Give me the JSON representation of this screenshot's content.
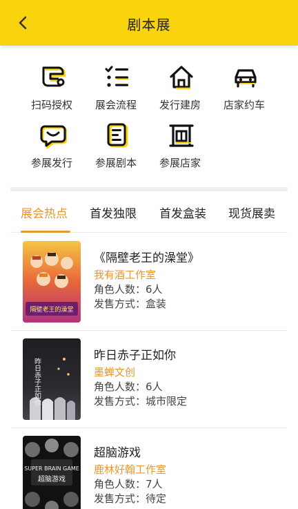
{
  "header": {
    "title": "剧本展",
    "back_icon": "chevron-left-icon",
    "color": "#f9d30d"
  },
  "menu": [
    {
      "label": "扫码授权",
      "icon": "scan-auth-icon"
    },
    {
      "label": "展会流程",
      "icon": "checklist-icon"
    },
    {
      "label": "发行建房",
      "icon": "house-icon"
    },
    {
      "label": "店家约车",
      "icon": "car-icon"
    },
    {
      "label": "参展发行",
      "icon": "chat-icon"
    },
    {
      "label": "参展剧本",
      "icon": "document-icon"
    },
    {
      "label": "参展店家",
      "icon": "shop-icon"
    }
  ],
  "tabs": [
    {
      "label": "展会热点",
      "active": true
    },
    {
      "label": "首发独限",
      "active": false
    },
    {
      "label": "首发盒装",
      "active": false
    },
    {
      "label": "现货展卖",
      "active": false
    }
  ],
  "accent": "#e8962e",
  "scripts": [
    {
      "title": "《隔壁老王的澡堂》",
      "studio": "我有酒工作室",
      "roles_label": "角色人数：",
      "roles": "6人",
      "sale_label": "发售方式：",
      "sale": "盒装",
      "cover_text": "隔壁老王的澡堂"
    },
    {
      "title": "昨日赤子正如你",
      "studio": "墨蝉文创",
      "roles_label": "角色人数：",
      "roles": "6人",
      "sale_label": "发售方式：",
      "sale": "城市限定",
      "cover_text": "昨日赤子正如你"
    },
    {
      "title": "超脑游戏",
      "studio": "鹿林好翰工作室",
      "roles_label": "角色人数：",
      "roles": "7人",
      "sale_label": "发售方式：",
      "sale": "待定",
      "cover_text": "超脑游戏",
      "cover_text_en": "SUPER BRAIN GAME"
    }
  ]
}
